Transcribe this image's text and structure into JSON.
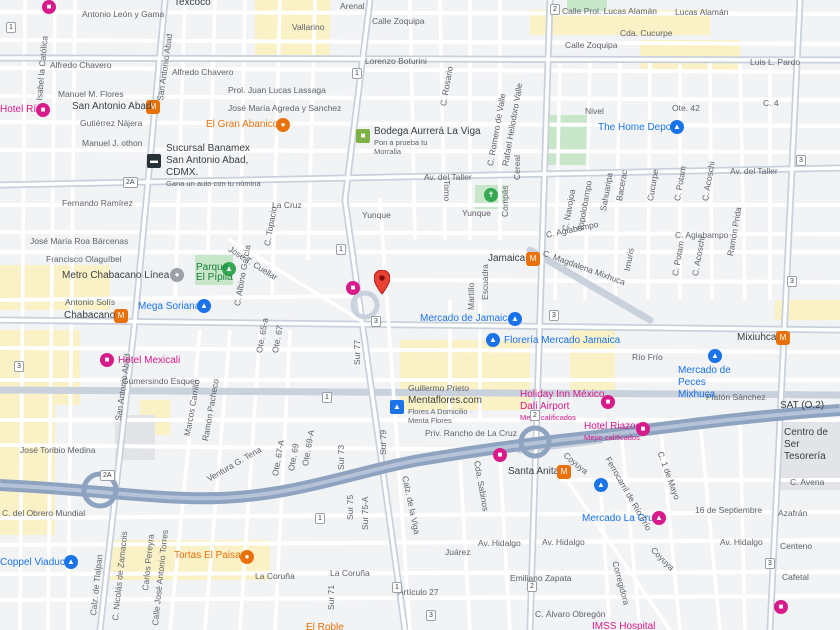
{
  "colors": {
    "background": "#f2f3f5",
    "road": "#ffffff",
    "major_road": "#c9d1dc",
    "freeway": "#8ea3c0",
    "park": "#c8e6c9",
    "commercial": "#fbf1c7",
    "metro_orange": "#e8710a",
    "store_blue": "#1a73e8",
    "hotel_pink": "#d81b8a",
    "selected_pin": "#ea4335"
  },
  "streets": {
    "antonio_leon_gama": "Antonio León y Gama",
    "calle_zoquipa_1": "Calle Zoquipa",
    "calle_prol_lucas_alaman": "Calle Prol. Lucas Alamán",
    "lucas_alaman": "Lucas Alamán",
    "calle_zoquipa_2": "Calle Zoquipa",
    "cda_cucurpe": "Cda. Cucurpe",
    "luis_l_pardo": "Luis L. Pardo",
    "vallarino": "Vallarino",
    "arenal": "Arenal",
    "lorenzo_boturini": "Lorenzo Boturini",
    "isabel_la_catolica_1": "Isabel la Católica",
    "alfredo_chavero_1": "Alfredo Chavero",
    "alfredo_chavero_2": "Alfredo Chavero",
    "manuel_m_flores": "Manuel M. Flores",
    "prol_juan_lucas_lassaga": "Prol. Juan Lucas Lassaga",
    "jose_maria_agreda": "José María Agreda y Sanchez",
    "gutierrez_najera": "Gutiérrez Nájera",
    "manuel_othon": "Manuel J. othon",
    "av_del_taller_1": "Av. del Taller",
    "av_del_taller_2": "Av. del Taller",
    "fernando_ramirez": "Fernando Ramírez",
    "la_cruz": "La Cruz",
    "yunque_1": "Yunque",
    "yunque_2": "Yunque",
    "jose_maria_roa_barcenas": "José María Roa Bárcenas",
    "francisco_olaguibel": "Francisco Olaguíbel",
    "jose_t_cuellar": "Jose T. Cuellar",
    "c_agiabampo_1": "C. Agiabampo",
    "c_agiabampo_2": "C. Agiabampo",
    "c_magdalena_mixhuca": "C. Magdalena Mixhuca",
    "antonio_solis": "Antonio Solís",
    "rio_frio_1": "Río Frío",
    "gumersindo_esquer": "Gumersindo Esquer",
    "guillermo_prieto": "Guillermo Prieto",
    "platon_sanchez": "Platón Sánchez",
    "priv_rancho_la_cruz": "Priv. Rancho de La Cruz",
    "jose_toribio_medina": "José Toribio Medina",
    "ventura_g_tena": "Ventura G. Tena",
    "coyuya_1": "Coyuya",
    "c_16_septiembre": "16 de Septiembre",
    "c_avena": "C. Avena",
    "azafran": "Azafrán",
    "centeno": "Centeno",
    "c_obrero_mundial": "C. del Obrero Mundial",
    "calz_tlalpan": "Calz. de Tlalpan",
    "av_hidalgo_1": "Av. Hidalgo",
    "av_hidalgo_2": "Av. Hidalgo",
    "av_hidalgo_3": "Av. Hidalgo",
    "juarez": "Juárez",
    "emiliano_zapata": "Emiliano Zapata",
    "cafetal": "Cafetal",
    "la_coruna_1": "La Coruña",
    "la_coruna_2": "La Coruña",
    "articulo_27": "Artículo 27",
    "c_alvaro_obregon": "C. Álvaro Obregón",
    "cereal": "Cereal",
    "nivel": "Nivel",
    "ote_42": "Ote. 42",
    "c4": "C. 4",
    "san_antonio_abad_1": "San Antonio Abad",
    "san_antonio_abad_2": "San Antonio Abad",
    "calz_de_la_viga": "Calz. de la Viga",
    "torno": "Torno",
    "compas": "Compás",
    "martillo": "Martillo",
    "escuadra": "Escuadra",
    "sur_77": "Sur 77",
    "sur_73": "Sur 73",
    "sur_79": "Sur 79",
    "sur_75": "Sur 75",
    "sur_75a": "Sur 75-A",
    "sur_71": "Sur 71",
    "c_topacio": "C. Topacio",
    "c_albino_garcia": "C. Albino García",
    "ote_65a": "Ote. 65-a",
    "ote_67": "Ote. 67",
    "ote_67a": "Ote. 67-A",
    "ote_69": "Ote. 69",
    "ote_69a": "Ote. 69-A",
    "ramon_pacheco": "Ramón Pacheco",
    "marcos_carrillo": "Marcos Carrillo",
    "coyuya_2": "Coyuya",
    "ferrocarril_rio_frio": "Ferrocarril de Río Frío",
    "c_1_mayo": "C. 1 de Mayo",
    "c_sabinos": "Cda. Sabinos",
    "corregidora": "Corregidora",
    "calle_jose_antonio_torres": "Calle José Antonio Torres",
    "carlos_pereyra": "Carlos Pereyra",
    "c_nicolas_zamacois": "C. Nicolás de Zamacois",
    "c_rosario": "C. Rosario",
    "c_romero_de_valle": "C. Romero de Valle",
    "rafael_heliodoro_valle": "Rafael Heliodoro Valle",
    "c_navojoa": "C. Navojoa",
    "topolobampo": "Topolobampo",
    "sahuaripa": "Sahuaripa",
    "bacerac": "Bacerac",
    "cucurpe": "Cucurpe",
    "c_potam": "C. Potam",
    "c_acoschi": "C. Acoschi",
    "ramon_prida": "Ramón Prida",
    "imuris": "Imuris",
    "c_potam_2": "C. Potam",
    "c_acoschi_2": "C. Acoschi"
  },
  "places": {
    "texcoco": "Texcoco",
    "san_antonio_abad": "San Antonio Abad",
    "hotel_rio": "Hotel Río",
    "el_gran_abanico": "El Gran Abanico",
    "sucursal_banamex": "Sucursal Banamex San Antonio Abad, CDMX.",
    "sucursal_banamex_sub": "Gana un auto con tu nómina",
    "bodega_aurrera": "Bodega Aurrerá La Viga",
    "bodega_aurrera_sub": "Pon a prueba tu Morralla",
    "the_home_depot": "The Home Depot",
    "metro_chabacano_l8": "Metro Chabacano Línea 8",
    "parque_el_pipila": "Parque El Pípila",
    "jamaica": "Jamaica",
    "chabacano": "Chabacano",
    "mega_soriana": "Mega Soriana",
    "mercado_jamaica": "Mercado de Jamaica",
    "floreria_mercado_jamaica": "Florería Mercado Jamaica",
    "mixiuhca": "Mixiuhca",
    "hotel_mexicali": "Hotel Mexicali",
    "mercado_peces": "Mercado de Peces Mixhuca",
    "mentaflores": "Mentaflores.com",
    "mentaflores_sub": "Flores A Domicilio · Menta Flores",
    "holiday_inn": "Holiday Inn México Dalí Airport",
    "holiday_inn_sub": "Mejor calificados",
    "hotel_riazor": "Hotel Riazor",
    "hotel_riazor_sub": "Mejor calificados",
    "sat": "SAT (O.2)",
    "centro_servicio": "Centro de Ser Tesorería",
    "santa_anita": "Santa Anita",
    "mercado_la_cruz": "Mercado La Cruz",
    "tortas_el_paisa": "Tortas El Paisa",
    "oppel_viaducto": "Coppel Viaducto",
    "imss_hospital": "IMSS Hospital",
    "el_roble": "El Roble"
  },
  "route_shields": [
    "1",
    "2",
    "3",
    "2A",
    "2A",
    "3",
    "1",
    "3",
    "3",
    "3",
    "1",
    "2",
    "1",
    "2",
    "3",
    "1",
    "1",
    "3"
  ],
  "selected_pin": {
    "label": ""
  }
}
